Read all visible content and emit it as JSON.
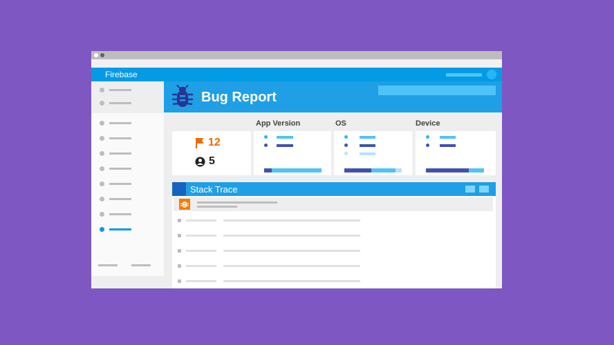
{
  "app": {
    "brand": "Firebase"
  },
  "header": {
    "title": "Bug Report",
    "icon": "bug-icon"
  },
  "summary": {
    "crashes": {
      "icon": "flag-icon",
      "value": "12",
      "color": "#ef6c00"
    },
    "users": {
      "icon": "user-icon",
      "value": "5",
      "color": "#212121"
    }
  },
  "columns": [
    {
      "label": "App Version"
    },
    {
      "label": "OS"
    },
    {
      "label": "Device"
    }
  ],
  "stack_trace": {
    "title": "Stack Trace",
    "icon": "bug-icon"
  },
  "colors": {
    "background": "#7e57c2",
    "primary": "#039be5",
    "header": "#1e9fe6",
    "dark_series": "#3f51b5",
    "light_series": "#4fc3f7",
    "alert": "#f57c00"
  }
}
